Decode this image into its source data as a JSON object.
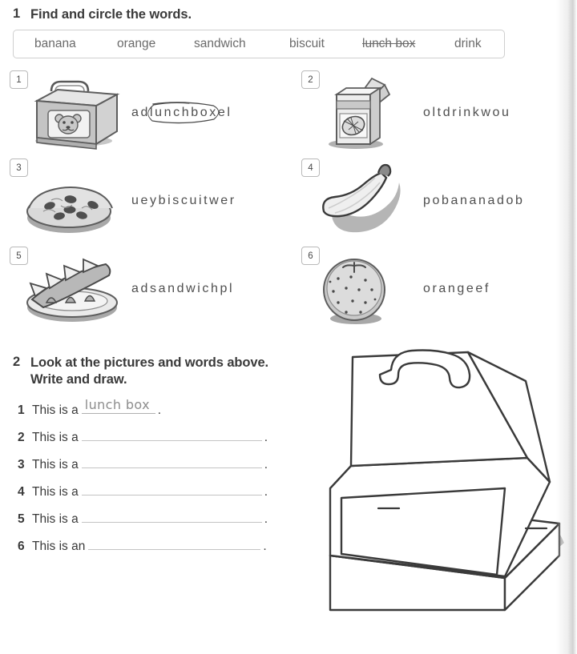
{
  "page": {
    "background": "#ffffff",
    "text_color": "#3b3b3b",
    "rule_color": "#c4c4c4"
  },
  "exercises": [
    {
      "number": "1",
      "title": "Find and circle the words.",
      "word_bank": [
        {
          "word": "banana",
          "struck_through": false
        },
        {
          "word": "orange",
          "struck_through": false
        },
        {
          "word": "sandwich",
          "struck_through": false
        },
        {
          "word": "biscuit",
          "struck_through": false
        },
        {
          "word": "lunch box",
          "struck_through": true
        },
        {
          "word": "drink",
          "struck_through": false
        }
      ],
      "items": [
        {
          "number": "1",
          "picture": "lunch-box-with-bear-face",
          "scramble_before": "ad",
          "scramble_target": "lunchbox",
          "scramble_after": "el",
          "circled": true
        },
        {
          "number": "2",
          "picture": "juice-carton-with-straw",
          "scramble_before": "",
          "scramble_target": "oltdrinkwou",
          "scramble_after": "",
          "circled": false
        },
        {
          "number": "3",
          "picture": "chocolate-chip-biscuit",
          "scramble_before": "",
          "scramble_target": "ueybiscuitwer",
          "scramble_after": "",
          "circled": false
        },
        {
          "number": "4",
          "picture": "banana",
          "scramble_before": "",
          "scramble_target": "pobananadob",
          "scramble_after": "",
          "circled": false
        },
        {
          "number": "5",
          "picture": "sandwiches-on-plate",
          "scramble_before": "",
          "scramble_target": "adsandwichpl",
          "scramble_after": "",
          "circled": false
        },
        {
          "number": "6",
          "picture": "orange-fruit",
          "scramble_before": "",
          "scramble_target": "orangeef",
          "scramble_after": "",
          "circled": false
        }
      ]
    },
    {
      "number": "2",
      "title_line1": "Look at the pictures and words above.",
      "title_line2": "Write and draw.",
      "answers": [
        {
          "number": "1",
          "stem": "This is a",
          "written": "lunch box",
          "period": "."
        },
        {
          "number": "2",
          "stem": "This is a",
          "written": "",
          "period": "."
        },
        {
          "number": "3",
          "stem": "This is a",
          "written": "",
          "period": "."
        },
        {
          "number": "4",
          "stem": "This is a",
          "written": "",
          "period": "."
        },
        {
          "number": "5",
          "stem": "This is a",
          "written": "",
          "period": "."
        },
        {
          "number": "6",
          "stem": "This is an",
          "written": "",
          "period": "."
        }
      ],
      "drawing_area": "open-empty-lunch-box-outline"
    }
  ]
}
